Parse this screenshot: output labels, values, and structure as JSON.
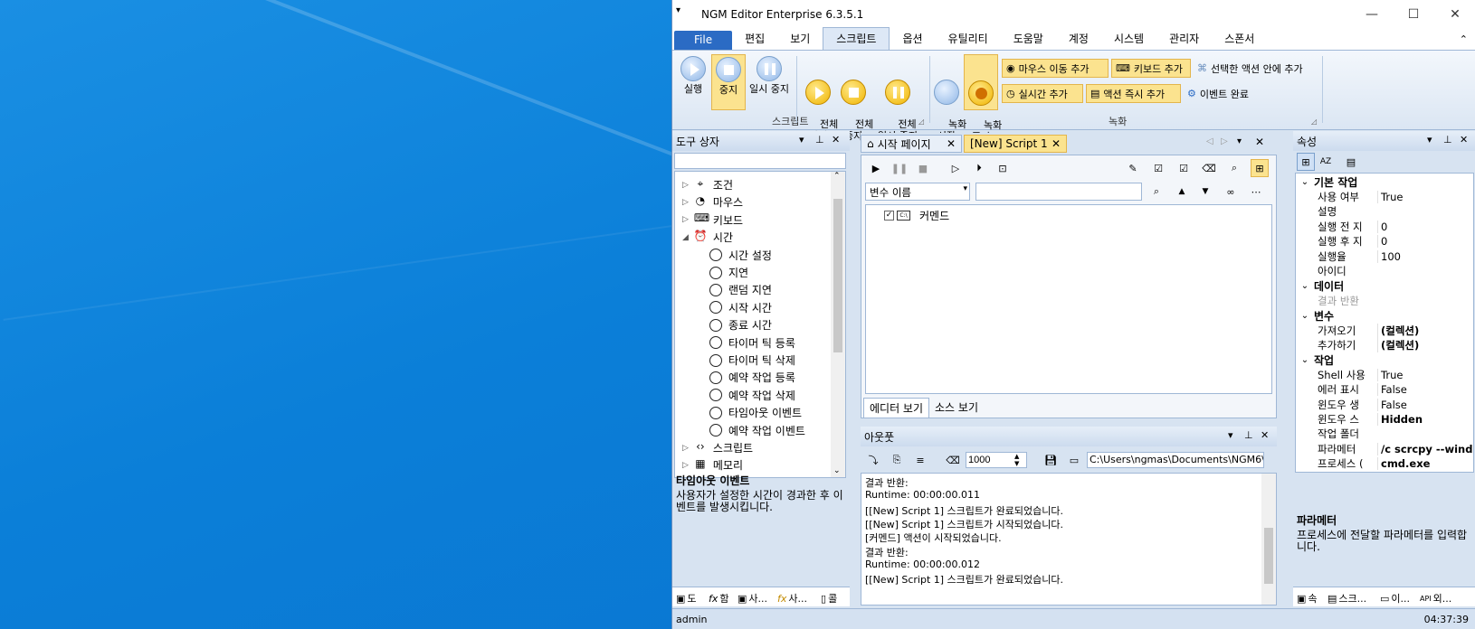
{
  "window": {
    "title": "NGM Editor  Enterprise 6.3.5.1",
    "minimize": "—",
    "maximize": "☐",
    "close": "✕"
  },
  "menu": [
    "File",
    "편집",
    "보기",
    "스크립트",
    "옵션",
    "유틸리티",
    "도움말",
    "계정",
    "시스템",
    "관리자",
    "스폰서"
  ],
  "ribbon": {
    "run": "실행",
    "stop": "중지",
    "pause": "일시 중지",
    "all_run": "전체\n실행",
    "all_stop": "전체\n중지",
    "all_pause": "전체\n일시 중지",
    "script_group": "스크립트",
    "rec_start": "녹화\n시작",
    "rec_stop": "녹화\n중지",
    "add_mouse": "마우스 이동 추가",
    "add_keyboard": "키보드 추가",
    "add_in_action": "선택한 액션 안에 추가",
    "add_realtime": "실시간 추가",
    "add_immediate": "액션 즉시 추가",
    "event_done": "이벤트 완료",
    "rec_group": "녹화"
  },
  "toolbox": {
    "title": "도구 상자",
    "items": [
      {
        "label": "조건",
        "level": 0,
        "arrow": "▷"
      },
      {
        "label": "마우스",
        "level": 0,
        "arrow": "▷"
      },
      {
        "label": "키보드",
        "level": 0,
        "arrow": "▷"
      },
      {
        "label": "시간",
        "level": 0,
        "arrow": "◢"
      },
      {
        "label": "시간 설정",
        "level": 1
      },
      {
        "label": "지연",
        "level": 1
      },
      {
        "label": "랜덤 지연",
        "level": 1
      },
      {
        "label": "시작 시간",
        "level": 1
      },
      {
        "label": "종료 시간",
        "level": 1
      },
      {
        "label": "타이머 틱 등록",
        "level": 1
      },
      {
        "label": "타이머 틱 삭제",
        "level": 1
      },
      {
        "label": "예약 작업 등록",
        "level": 1
      },
      {
        "label": "예약 작업 삭제",
        "level": 1
      },
      {
        "label": "타임아웃 이벤트",
        "level": 1
      },
      {
        "label": "예약 작업 이벤트",
        "level": 1
      },
      {
        "label": "스크립트",
        "level": 0,
        "arrow": "▷"
      },
      {
        "label": "메모리",
        "level": 0,
        "arrow": "▷"
      }
    ],
    "desc_title": "타임아웃 이벤트",
    "desc_text": "사용자가 설정한 시간이 경과한 후 이벤트를 발생시킵니다.",
    "bottom_tabs": [
      "도",
      "함",
      "사...",
      "사...",
      "콜"
    ]
  },
  "editor": {
    "tabs": [
      "시작 페이지",
      "[New] Script 1"
    ],
    "var_select": "변수 이름",
    "tree_item": "커멘드",
    "bottom_tabs": [
      "에디터 보기",
      "소스 보기"
    ]
  },
  "output": {
    "title": "아웃풋",
    "count": "1000",
    "path": "C:\\Users\\ngmas\\Documents\\NGM6\\",
    "lines": [
      "결과 반환:",
      "Runtime: 00:00:00.011",
      "[[New] Script 1] 스크립트가 완료되었습니다.",
      "[[New] Script 1] 스크립트가 시작되었습니다.",
      "[커멘드] 액션이 시작되었습니다.",
      "결과 반환:",
      "Runtime: 00:00:00.012",
      "[[New] Script 1] 스크립트가 완료되었습니다."
    ]
  },
  "properties": {
    "title": "속성",
    "rows": [
      {
        "cat": "기본 작업"
      },
      {
        "k": "사용 여부",
        "v": "True"
      },
      {
        "k": "설명",
        "v": ""
      },
      {
        "k": "실행 전 지",
        "v": "0"
      },
      {
        "k": "실행 후 지",
        "v": "0"
      },
      {
        "k": "실행율",
        "v": "100"
      },
      {
        "k": "아이디",
        "v": ""
      },
      {
        "cat": "데이터"
      },
      {
        "k": "결과 반환",
        "v": "",
        "gray": true
      },
      {
        "cat": "변수"
      },
      {
        "k": "가져오기",
        "v": "(컬렉션)",
        "bold": true
      },
      {
        "k": "추가하기",
        "v": "(컬렉션)",
        "bold": true
      },
      {
        "cat": "작업"
      },
      {
        "k": "Shell 사용",
        "v": "True"
      },
      {
        "k": "에러 표시",
        "v": "False"
      },
      {
        "k": "윈도우 생",
        "v": "False"
      },
      {
        "k": "윈도우 스",
        "v": "Hidden",
        "bold": true
      },
      {
        "k": "작업 폴더",
        "v": ""
      },
      {
        "k": "파라메터",
        "v": "/c scrcpy --wind",
        "bold": true
      },
      {
        "k": "프로세스 (",
        "v": "cmd.exe",
        "bold": true
      }
    ],
    "desc_title": "파라메터",
    "desc_text": "프로세스에 전달할 파라메터를 입력합니다.",
    "bottom_tabs": [
      "속",
      "스크...",
      "이...",
      "외..."
    ]
  },
  "status": {
    "user": "admin",
    "time": "04:37:39"
  }
}
